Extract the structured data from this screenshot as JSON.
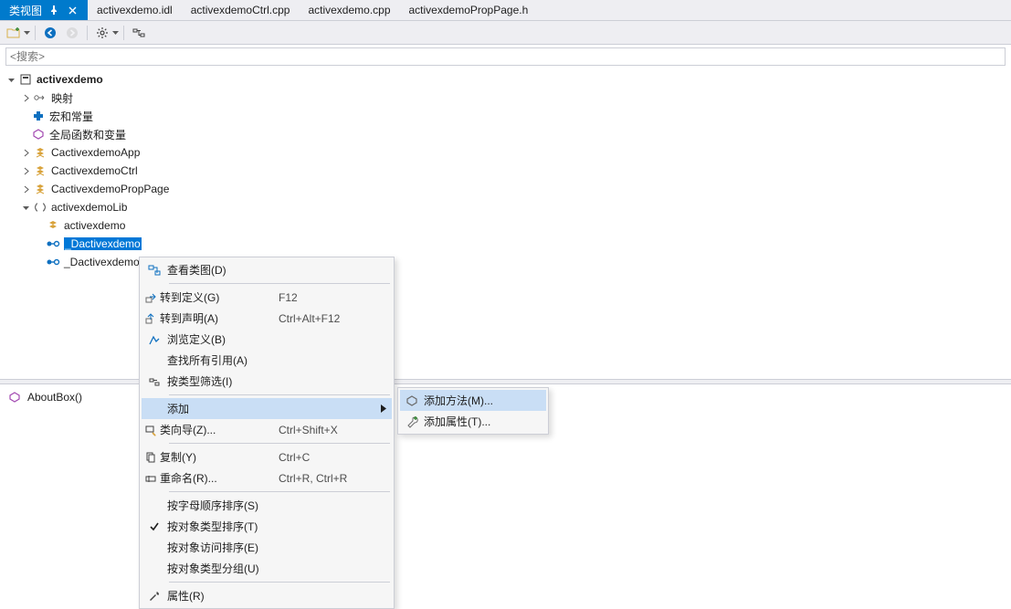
{
  "tabs": {
    "active": "类视图",
    "items": [
      "activexdemo.idl",
      "activexdemoCtrl.cpp",
      "activexdemo.cpp",
      "activexdemoPropPage.h"
    ]
  },
  "search": {
    "placeholder": "<搜索>"
  },
  "tree": {
    "root": "activexdemo",
    "nodes": {
      "map": "映射",
      "macros": "宏和常量",
      "globals": "全局函数和变量",
      "app": "CactivexdemoApp",
      "ctrl": "CactivexdemoCtrl",
      "prop": "CactivexdemoPropPage",
      "lib": "activexdemoLib",
      "lib_ns": "activexdemo",
      "lib_d1": "_Dactivexdemo",
      "lib_d2": "_DactivexdemoEvents"
    }
  },
  "lowerPane": {
    "item": "AboutBox()"
  },
  "contextMenu": {
    "viewClassDiagram": "查看类图(D)",
    "gotoDef": {
      "label": "转到定义(G)",
      "shortcut": "F12"
    },
    "gotoDecl": {
      "label": "转到声明(A)",
      "shortcut": "Ctrl+Alt+F12"
    },
    "browseDef": "浏览定义(B)",
    "findRef": "查找所有引用(A)",
    "filterType": "按类型筛选(I)",
    "add": "添加",
    "classWizard": {
      "label": "类向导(Z)...",
      "shortcut": "Ctrl+Shift+X"
    },
    "copy": {
      "label": "复制(Y)",
      "shortcut": "Ctrl+C"
    },
    "rename": {
      "label": "重命名(R)...",
      "shortcut": "Ctrl+R, Ctrl+R"
    },
    "sortAlpha": "按字母顺序排序(S)",
    "sortObjType": "按对象类型排序(T)",
    "sortObjAccess": "按对象访问排序(E)",
    "groupObjType": "按对象类型分组(U)",
    "properties": "属性(R)"
  },
  "submenu": {
    "addMethod": "添加方法(M)...",
    "addProperty": "添加属性(T)..."
  }
}
